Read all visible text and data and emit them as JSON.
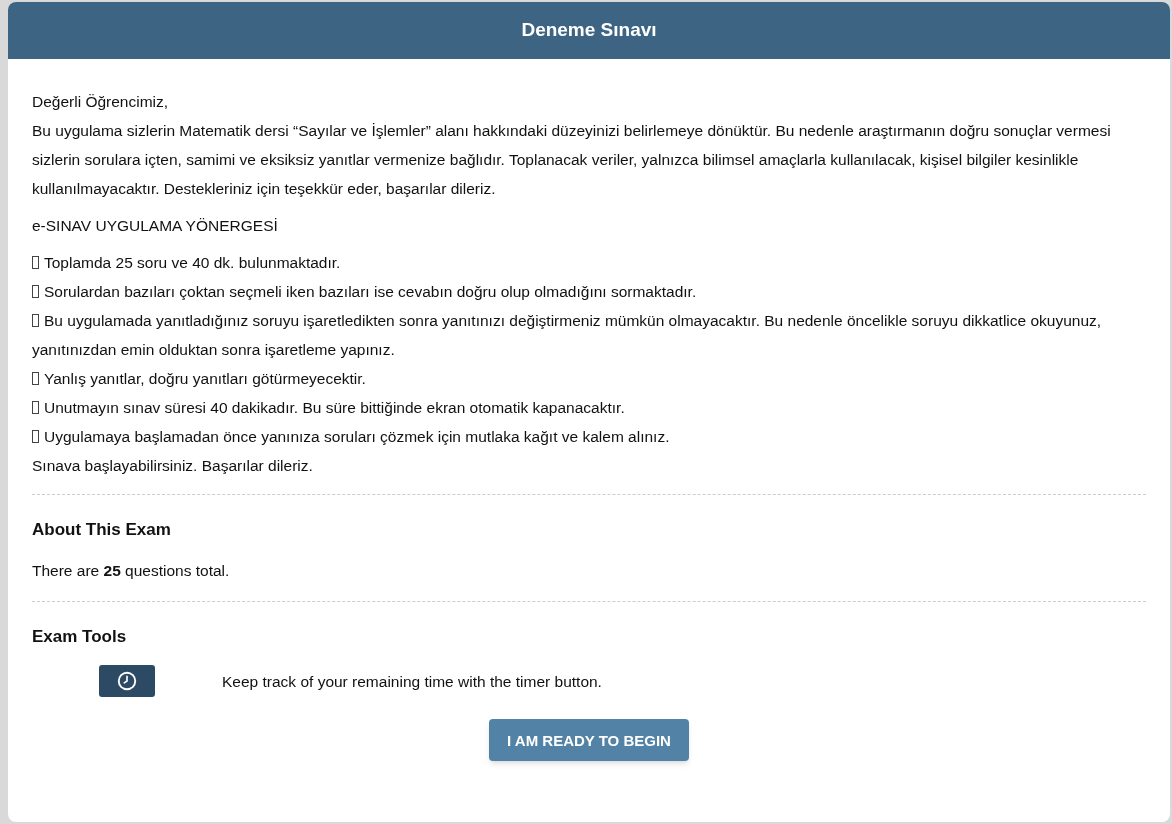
{
  "header": {
    "title": "Deneme Sınavı"
  },
  "intro": {
    "greeting": "Değerli Öğrencimiz,",
    "paragraph": "Bu uygulama sizlerin Matematik dersi “Sayılar ve İşlemler” alanı hakkındaki düzeyinizi belirlemeye dönüktür. Bu nedenle araştırmanın doğru sonuçlar vermesi sizlerin sorulara içten, samimi ve eksiksiz yanıtlar vermenize bağlıdır. Toplanacak veriler, yalnızca bilimsel amaçlarla kullanılacak, kişisel bilgiler kesinlikle kullanılmayacaktır. Destekleriniz için teşekkür eder, başarılar dileriz."
  },
  "instructions": {
    "heading": "e-SINAV UYGULAMA YÖNERGESİ",
    "items": [
      "Toplamda 25 soru ve 40 dk. bulunmaktadır.",
      "Sorulardan bazıları çoktan seçmeli iken bazıları ise cevabın doğru olup olmadığını sormaktadır.",
      "Bu uygulamada yanıtladığınız soruyu işaretledikten sonra yanıtınızı değiştirmeniz mümkün olmayacaktır. Bu nedenle öncelikle soruyu dikkatlice okuyunuz, yanıtınızdan emin olduktan sonra işaretleme yapınız.",
      "Yanlış yanıtlar, doğru yanıtları götürmeyecektir.",
      "Unutmayın sınav süresi 40 dakikadır. Bu süre bittiğinde ekran otomatik kapanacaktır.",
      "Uygulamaya başlamadan önce yanınıza soruları çözmek için mutlaka kağıt ve kalem alınız."
    ],
    "closing": "Sınava başlayabilirsiniz. Başarılar dileriz."
  },
  "about": {
    "heading": "About This Exam",
    "text": "There are **25** questions total."
  },
  "tools": {
    "heading": "Exam Tools",
    "items": [
      {
        "kind": "timer",
        "description": "Keep track of your remaining time with the timer button."
      }
    ]
  },
  "start_button": "I AM READY TO BEGIN"
}
